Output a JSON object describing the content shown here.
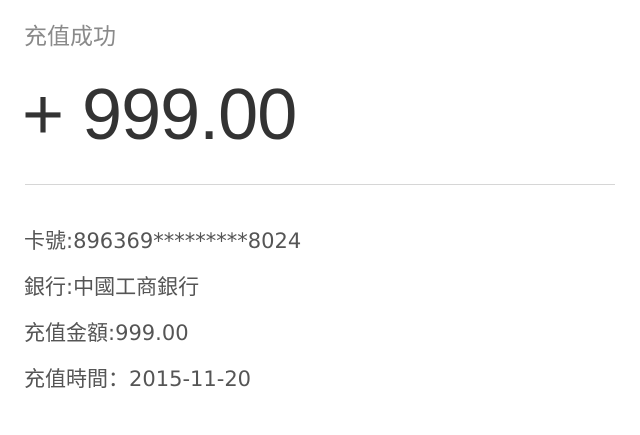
{
  "status": {
    "title": "充值成功"
  },
  "amount": {
    "value": "+ 999.00"
  },
  "details": [
    {
      "label": "卡號:",
      "value": "896369*********8024"
    },
    {
      "label": "銀行:",
      "value": "中國工商銀行"
    },
    {
      "label": "充值金額:",
      "value": "999.00"
    },
    {
      "label": "充值時間：",
      "value": "2015-11-20"
    }
  ],
  "colors": {
    "title": "#8a8a8a",
    "amount": "#333333",
    "detail_text": "#555555",
    "divider": "#d6d6d6"
  }
}
